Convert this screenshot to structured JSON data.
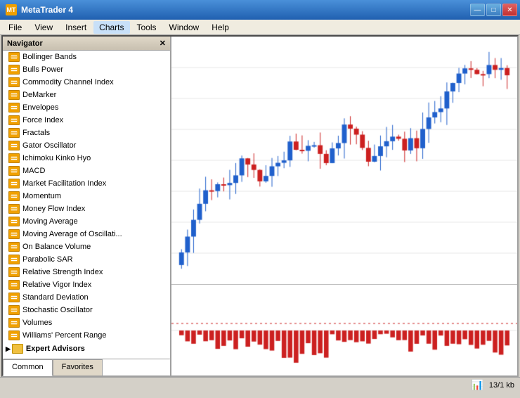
{
  "titleBar": {
    "appName": "MetaTrader 4",
    "controls": {
      "minimize": "—",
      "maximize": "□",
      "close": "✕"
    }
  },
  "menuBar": {
    "items": [
      "File",
      "View",
      "Insert",
      "Charts",
      "Tools",
      "Window",
      "Help"
    ]
  },
  "navigator": {
    "title": "Navigator",
    "indicators": [
      "Bollinger Bands",
      "Bulls Power",
      "Commodity Channel Index",
      "DeMarker",
      "Envelopes",
      "Force Index",
      "Fractals",
      "Gator Oscillator",
      "Ichimoku Kinko Hyo",
      "MACD",
      "Market Facilitation Index",
      "Momentum",
      "Money Flow Index",
      "Moving Average",
      "Moving Average of Oscillati...",
      "On Balance Volume",
      "Parabolic SAR",
      "Relative Strength Index",
      "Relative Vigor Index",
      "Standard Deviation",
      "Stochastic Oscillator",
      "Volumes",
      "Williams' Percent Range"
    ],
    "folders": [
      "Expert Advisors"
    ],
    "tabs": [
      "Common",
      "Favorites"
    ]
  },
  "statusBar": {
    "info": "13/1 kb"
  }
}
